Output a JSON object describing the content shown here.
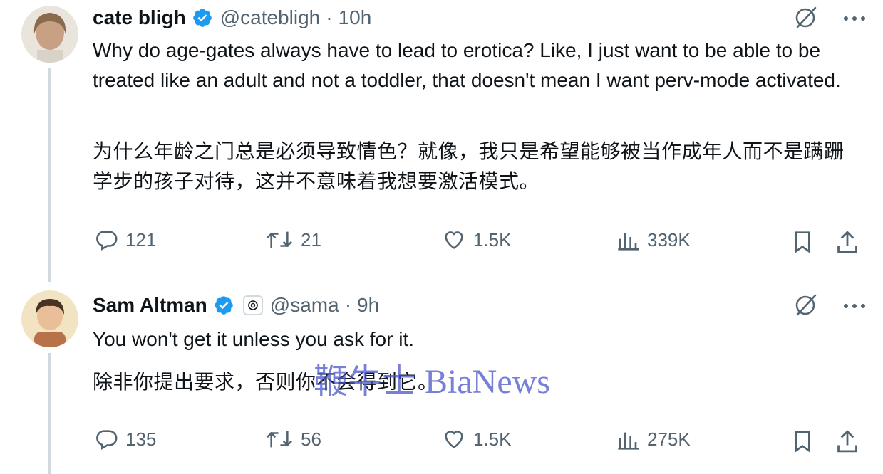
{
  "tweets": [
    {
      "author_name": "cate bligh",
      "handle": "@catebligh",
      "separator": "·",
      "time": "10h",
      "text_en": "Why do age-gates always have to lead to erotica? Like, I just want to be able to be treated like an adult and not a toddler, that doesn't mean I want perv-mode activated.",
      "text_zh": "为什么年龄之门总是必须导致情色？就像，我只是希望能够被当作成年人而不是蹒跚学步的孩子对待，这并不意味着我想要激活模式。",
      "replies": "121",
      "reposts": "21",
      "likes": "1.5K",
      "views": "339K"
    },
    {
      "author_name": "Sam Altman",
      "handle": "@sama",
      "separator": "·",
      "time": "9h",
      "text_en": "You won't get it unless you ask for it.",
      "text_zh": "除非你提出要求，否则你不会得到它。",
      "replies": "135",
      "reposts": "56",
      "likes": "1.5K",
      "views": "275K"
    }
  ],
  "watermark": "鞭牛士 BiaNews",
  "colors": {
    "verified": "#1d9bf0",
    "text": "#0f1419",
    "secondary": "#536471",
    "thread_line": "#cfd9de"
  },
  "icons": [
    "grok-icon",
    "more-icon",
    "reply-icon",
    "repost-icon",
    "like-icon",
    "views-icon",
    "bookmark-icon",
    "share-icon",
    "verified-icon"
  ]
}
